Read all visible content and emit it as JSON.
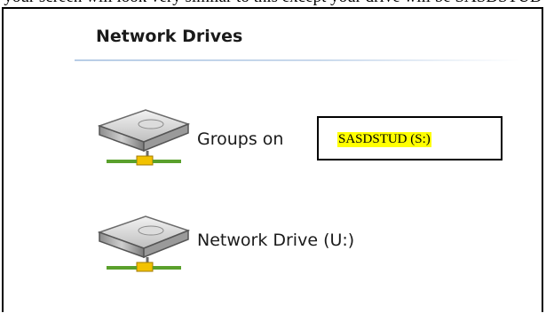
{
  "caption": {
    "text": "your screen will look very similar to this except your drive will be SASDSTUD"
  },
  "section": {
    "title": "Network Drives"
  },
  "drives": [
    {
      "label": "Groups on",
      "callout": "SASDSTUD (S:)",
      "icon": "network-drive-icon"
    },
    {
      "label": "Network Drive (U:)",
      "icon": "network-drive-icon"
    }
  ],
  "colors": {
    "highlight": "#ffff00",
    "header_rule": "#b8cde6"
  }
}
